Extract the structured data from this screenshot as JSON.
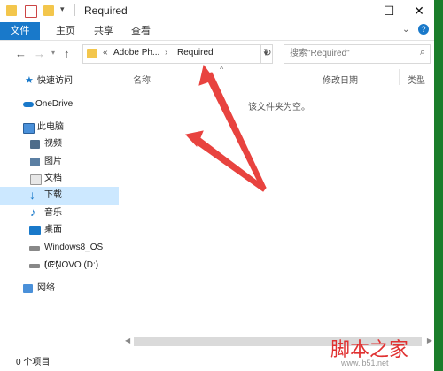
{
  "window": {
    "title": "Required"
  },
  "ribbon": {
    "tabs": [
      "文件",
      "主页",
      "共享",
      "查看"
    ]
  },
  "address": {
    "segments": [
      "«",
      "Adobe Ph...",
      "›",
      "Required"
    ]
  },
  "search": {
    "placeholder": "搜索\"Required\""
  },
  "sidebar": {
    "items": [
      {
        "label": "快速访问",
        "icon": "star-icon"
      },
      {
        "label": "OneDrive",
        "icon": "cloud-icon"
      },
      {
        "label": "此电脑",
        "icon": "computer-icon"
      },
      {
        "label": "视频",
        "icon": "video-folder-icon"
      },
      {
        "label": "图片",
        "icon": "pictures-folder-icon"
      },
      {
        "label": "文档",
        "icon": "documents-folder-icon"
      },
      {
        "label": "下载",
        "icon": "download-icon",
        "selected": true
      },
      {
        "label": "音乐",
        "icon": "music-icon"
      },
      {
        "label": "桌面",
        "icon": "desktop-icon"
      },
      {
        "label": "Windows8_OS (C:)",
        "icon": "drive-c-icon"
      },
      {
        "label": "LENOVO (D:)",
        "icon": "drive-d-icon"
      },
      {
        "label": "网络",
        "icon": "network-icon"
      }
    ]
  },
  "content": {
    "columns": [
      "名称",
      "修改日期",
      "类型"
    ],
    "empty_message": "该文件夹为空。"
  },
  "status": {
    "text": "0 个项目"
  },
  "watermark": {
    "main": "脚本之家",
    "url": "www.jb51.net"
  },
  "colors": {
    "accent": "#1979ca",
    "selection": "#cce8ff",
    "arrow": "#e8433f"
  }
}
